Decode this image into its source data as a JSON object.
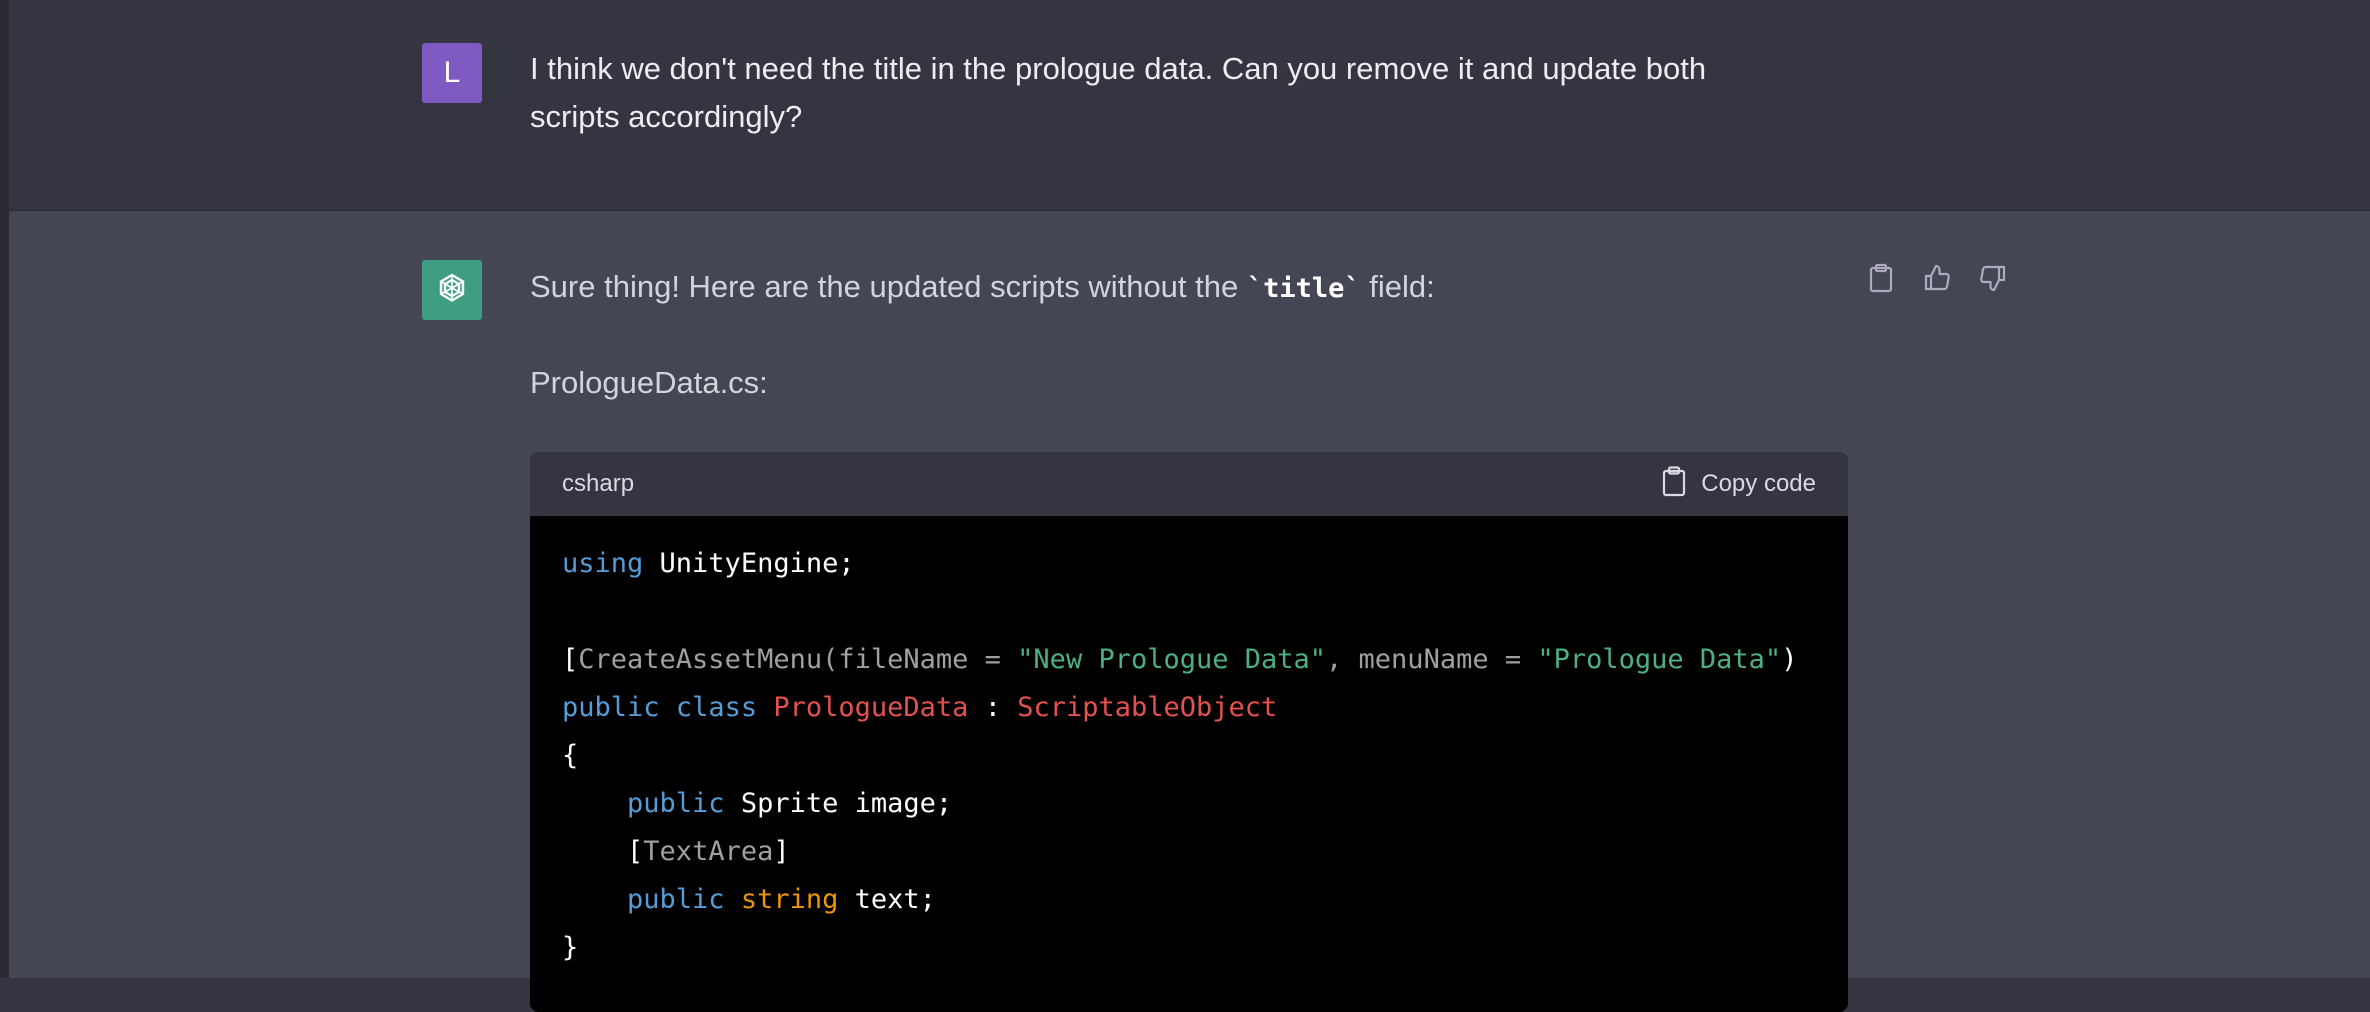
{
  "user_message": {
    "avatar_letter": "L",
    "text": "I think we don't need the title in the prologue data. Can you remove it and update both scripts accordingly?"
  },
  "assistant_message": {
    "intro_before": "Sure thing! Here are the updated scripts without the ",
    "intro_code": "`title`",
    "intro_after": " field:",
    "file_label": "PrologueData.cs:",
    "actions": {
      "copy_icon": "clipboard-icon",
      "like_icon": "thumbs-up-icon",
      "dislike_icon": "thumbs-down-icon"
    },
    "code_block": {
      "language": "csharp",
      "copy_label": "Copy code",
      "lines": {
        "l1_kw": "using",
        "l1_rest": " UnityEngine;",
        "l3_open": "[",
        "l3_attr": "CreateAssetMenu(fileName = ",
        "l3_str1": "\"New Prologue Data\"",
        "l3_mid": ", menuName = ",
        "l3_str2": "\"Prologue Data\"",
        "l3_close": ")",
        "l4_kw1": "public",
        "l4_kw2": "class",
        "l4_cls": "PrologueData",
        "l4_colon": " : ",
        "l4_base": "ScriptableObject",
        "l5": "{",
        "l6_kw": "public",
        "l6_rest": " Sprite image;",
        "l7_open": "[",
        "l7_attr": "TextArea",
        "l7_close": "]",
        "l8_kw": "public",
        "l8_ty": "string",
        "l8_rest": " text;",
        "l9": "}"
      }
    }
  },
  "colors": {
    "user_bg": "#343541",
    "assistant_bg": "#444654",
    "user_avatar": "#7e5ac2",
    "gpt_avatar": "#3f9e82",
    "keyword": "#569cd6",
    "type": "#e9950c",
    "class": "#e55050",
    "string": "#4caf86"
  }
}
